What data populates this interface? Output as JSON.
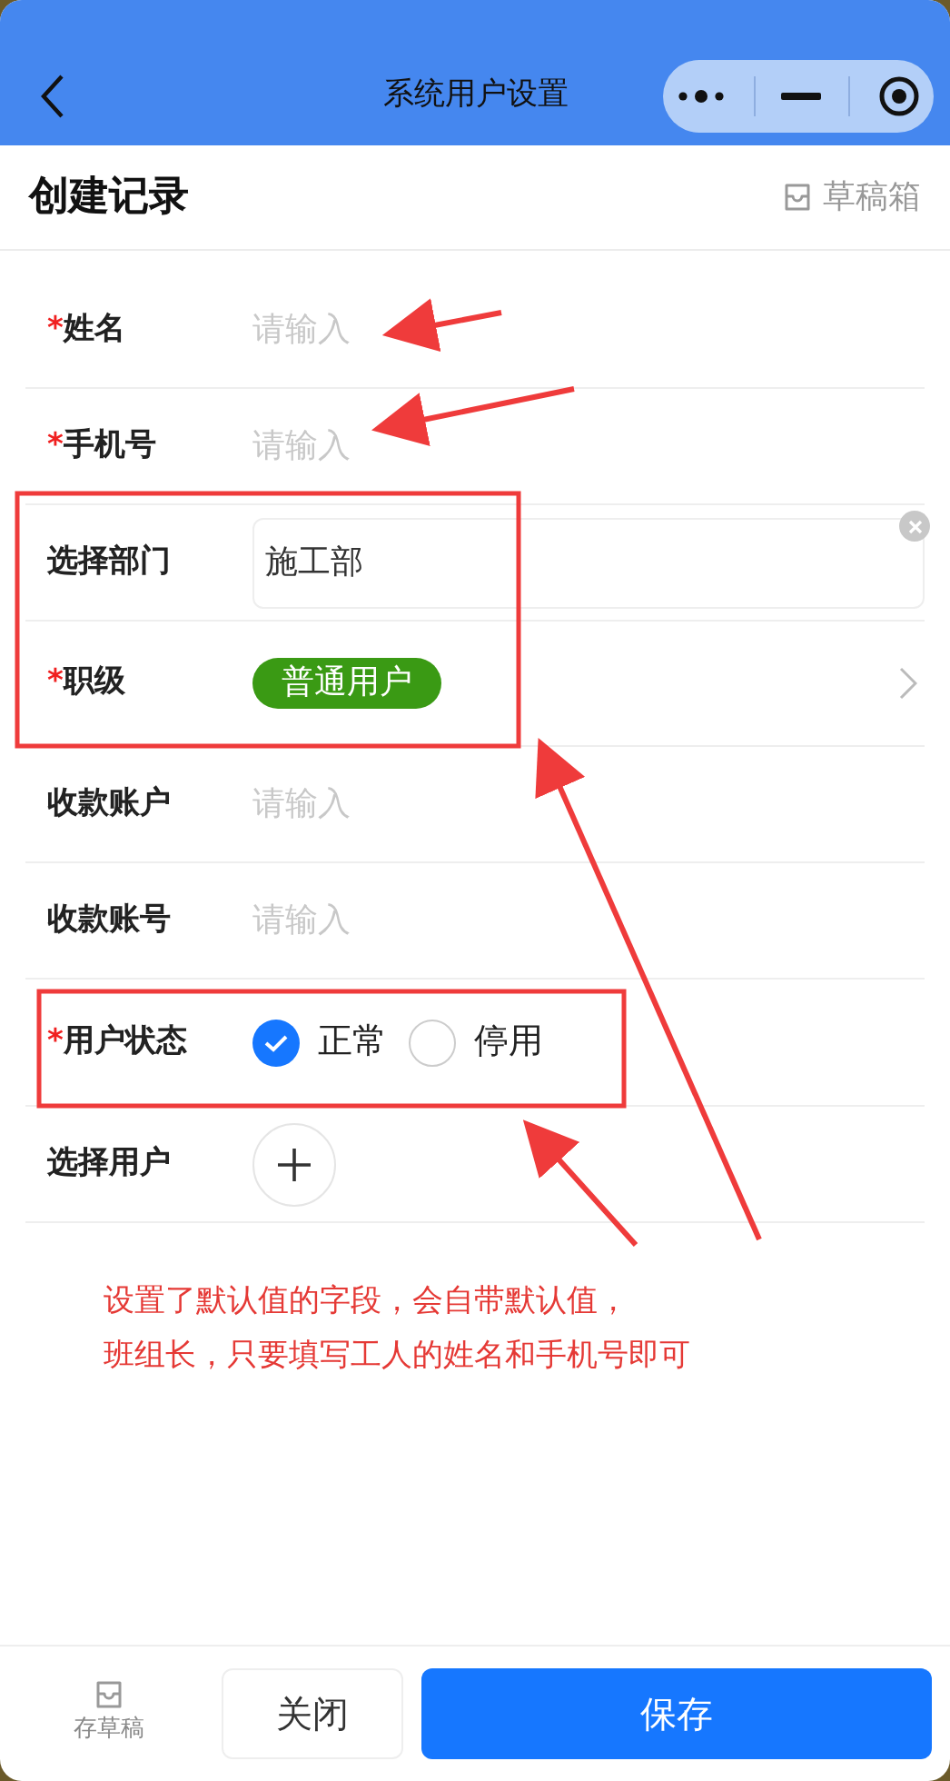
{
  "nav": {
    "title": "系统用户设置"
  },
  "header": {
    "title": "创建记录",
    "drafts_label": "草稿箱"
  },
  "fields": [
    {
      "kind": "text",
      "required_mark": "*",
      "label": "姓名",
      "placeholder": "请输入"
    },
    {
      "kind": "text",
      "required_mark": "*",
      "label": "手机号",
      "placeholder": "请输入"
    },
    {
      "kind": "select",
      "label": "选择部门",
      "value": "施工部"
    },
    {
      "kind": "tag",
      "required_mark": "*",
      "label": "职级",
      "value": "普通用户"
    },
    {
      "kind": "text",
      "label": "收款账户",
      "placeholder": "请输入"
    },
    {
      "kind": "text",
      "label": "收款账号",
      "placeholder": "请输入"
    },
    {
      "kind": "radio",
      "required_mark": "*",
      "label": "用户状态",
      "options": [
        {
          "label": "正常",
          "selected": true
        },
        {
          "label": "停用",
          "selected": false
        }
      ]
    },
    {
      "kind": "add",
      "label": "选择用户"
    }
  ],
  "annotation": {
    "lines": [
      "设置了默认值的字段，会自带默认值，",
      "班组长，只要填写工人的姓名和手机号即可"
    ]
  },
  "footer": {
    "draft_label": "存草稿",
    "close_label": "关闭",
    "save_label": "保存"
  }
}
